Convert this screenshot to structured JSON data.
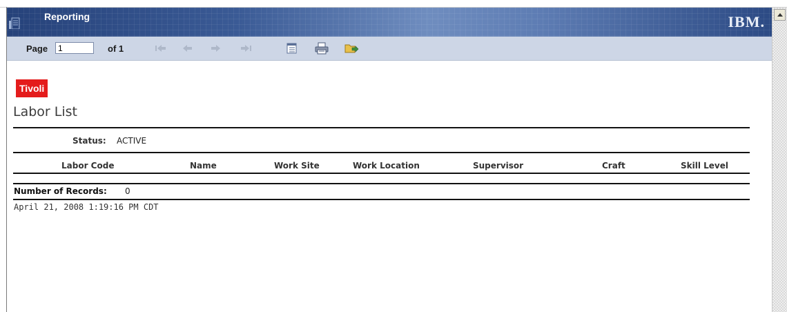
{
  "banner": {
    "title": "Reporting",
    "brand_logo": "IBM.",
    "brand_color": "#26427a"
  },
  "toolbar": {
    "page_label": "Page",
    "page_value": "1",
    "of_label": "of 1",
    "buttons": [
      "first-page-icon",
      "previous-page-icon",
      "next-page-icon",
      "last-page-icon",
      "table-of-contents-icon",
      "print-icon",
      "export-icon"
    ]
  },
  "report": {
    "product_badge": "Tivoli",
    "product_badge_color": "#e41c1c",
    "title": "Labor List",
    "status_label": "Status:",
    "status_value": "ACTIVE",
    "columns": [
      "Labor Code",
      "Name",
      "Work Site",
      "Work Location",
      "Supervisor",
      "Craft",
      "Skill Level"
    ],
    "records_label": "Number of Records:",
    "records_value": "0",
    "timestamp": "April 21, 2008 1:19:16 PM CDT"
  }
}
